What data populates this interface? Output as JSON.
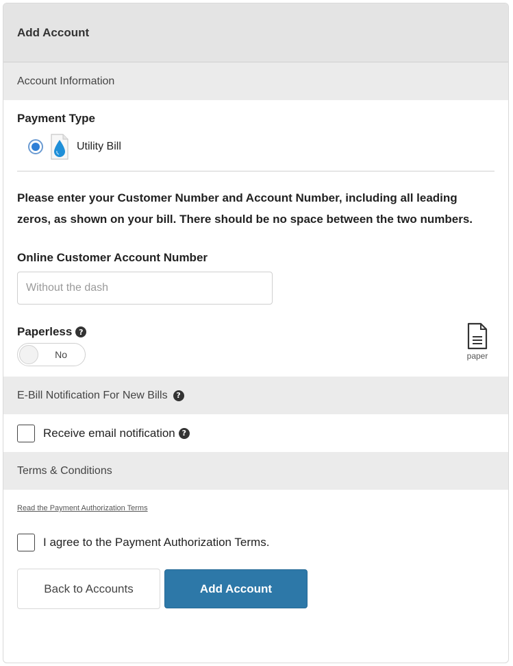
{
  "header": {
    "title": "Add Account"
  },
  "account_info": {
    "section_title": "Account Information",
    "payment_type_label": "Payment Type",
    "payment_type_option": "Utility Bill",
    "payment_type_selected": true,
    "instructions": "Please enter your Customer Number and Account Number, including all leading zeros, as shown on your bill. There should be no space between the two numbers.",
    "account_number": {
      "label": "Online Customer Account Number",
      "value": "",
      "placeholder": "Without the dash"
    },
    "paperless": {
      "label": "Paperless",
      "help_glyph": "?",
      "toggle_text": "No",
      "icon_caption": "paper"
    }
  },
  "ebill": {
    "section_title": "E-Bill Notification For New Bills",
    "help_glyph": "?",
    "checkbox_label": "Receive email notification",
    "checked": false
  },
  "terms": {
    "section_title": "Terms & Conditions",
    "link_text": "Read the Payment Authorization Terms",
    "agree_label": "I agree to the Payment Authorization Terms.",
    "checked": false
  },
  "actions": {
    "back_label": "Back to Accounts",
    "submit_label": "Add Account"
  },
  "colors": {
    "primary_button": "#2d78a8",
    "radio_selected": "#2f7fd6",
    "water_drop": "#1f8fd8"
  },
  "icons": {
    "payment_type": "water-drop-document-icon",
    "help": "question-circle-icon",
    "paper": "paper-document-icon"
  }
}
